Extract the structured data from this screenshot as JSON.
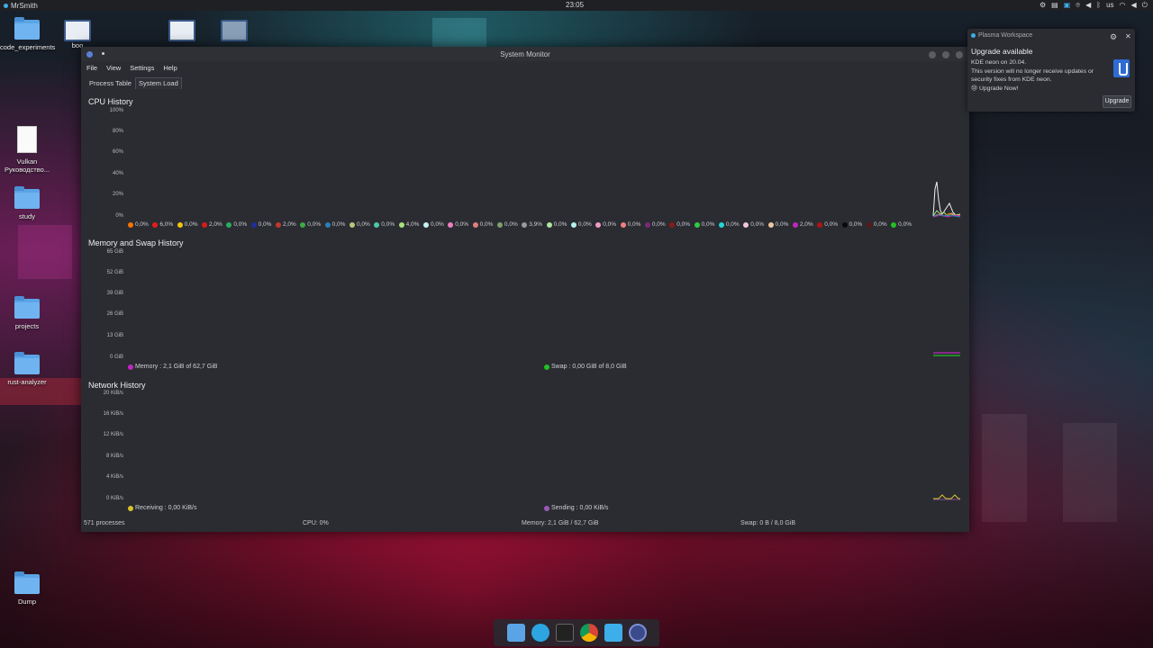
{
  "top_panel": {
    "user": "MrSmith",
    "clock": "23:05",
    "keyboard_layout": "us",
    "tray_icons": [
      "display-icon",
      "clipboard-icon",
      "discover-icon",
      "location-icon",
      "volume-icon",
      "bluetooth-icon",
      "keyboard-layout",
      "wifi-icon",
      "volume-icon-2",
      "power-icon"
    ]
  },
  "desktop": {
    "icons": [
      {
        "label": "code_experiments",
        "type": "folder"
      },
      {
        "label": "boo",
        "type": "app"
      },
      {
        "label": "",
        "type": "app"
      },
      {
        "label": "",
        "type": "app"
      },
      {
        "label": "Vulkan Руководство...",
        "type": "document"
      },
      {
        "label": "study",
        "type": "folder"
      },
      {
        "label": "projects",
        "type": "folder"
      },
      {
        "label": "rust-analyzer",
        "type": "folder"
      },
      {
        "label": "Dump",
        "type": "folder"
      }
    ]
  },
  "window": {
    "title": "System Monitor",
    "menu": [
      "File",
      "View",
      "Settings",
      "Help"
    ],
    "tabs": [
      {
        "label": "Process Table",
        "active": false
      },
      {
        "label": "System Load",
        "active": true
      }
    ],
    "cpu": {
      "title": "CPU History",
      "y_labels": [
        "100%",
        "80%",
        "60%",
        "40%",
        "20%",
        "0%"
      ],
      "legend": [
        {
          "color": "#f67400",
          "value": "0,0%"
        },
        {
          "color": "#e91a1a",
          "value": "6,0%"
        },
        {
          "color": "#f1c40f",
          "value": "0,0%"
        },
        {
          "color": "#d81b1b",
          "value": "2,0%"
        },
        {
          "color": "#27ae60",
          "value": "0,0%"
        },
        {
          "color": "#1d2f9a",
          "value": "0,0%"
        },
        {
          "color": "#c0392b",
          "value": "2,0%"
        },
        {
          "color": "#3daa42",
          "value": "0,0%"
        },
        {
          "color": "#2980b9",
          "value": "0,0%"
        },
        {
          "color": "#b4c97a",
          "value": "0,0%"
        },
        {
          "color": "#4ec9a7",
          "value": "0,0%"
        },
        {
          "color": "#a8e27c",
          "value": "4,0%"
        },
        {
          "color": "#c6f1f5",
          "value": "0,0%"
        },
        {
          "color": "#ef7fbf",
          "value": "0,0%"
        },
        {
          "color": "#e27f7f",
          "value": "0,0%"
        },
        {
          "color": "#7f9f6f",
          "value": "0,0%"
        },
        {
          "color": "#9a9a9a",
          "value": "3,9%"
        },
        {
          "color": "#aee6a0",
          "value": "0,0%"
        },
        {
          "color": "#b8f0f0",
          "value": "0,0%"
        },
        {
          "color": "#f19ac8",
          "value": "0,0%"
        },
        {
          "color": "#f08080",
          "value": "0,0%"
        },
        {
          "color": "#7a2a7a",
          "value": "0,0%"
        },
        {
          "color": "#8a1a1a",
          "value": "0,0%"
        },
        {
          "color": "#2ecc40",
          "value": "0,0%"
        },
        {
          "color": "#22d6d6",
          "value": "0,0%"
        },
        {
          "color": "#f2c6d6",
          "value": "0,0%"
        },
        {
          "color": "#f0c6a0",
          "value": "0,0%"
        },
        {
          "color": "#c026c0",
          "value": "2,0%"
        },
        {
          "color": "#b01414",
          "value": "0,0%"
        },
        {
          "color": "#0a0a0a",
          "value": "0,0%"
        },
        {
          "color": "#5a1a1a",
          "value": "0,0%"
        },
        {
          "color": "#22c022",
          "value": "0,0%"
        }
      ]
    },
    "memory": {
      "title": "Memory and Swap History",
      "y_labels": [
        "65 GiB",
        "52 GiB",
        "39 GiB",
        "26 GiB",
        "13 GiB",
        "0 GiB"
      ],
      "memory_label": "Memory : 2,1 GiB of 62,7 GiB",
      "memory_color": "#c026c0",
      "swap_label": "Swap : 0,00 GiB of 8,0 GiB",
      "swap_color": "#22c022"
    },
    "network": {
      "title": "Network History",
      "y_labels": [
        "20 KiB/s",
        "16 KiB/s",
        "12 KiB/s",
        "8 KiB/s",
        "4 KiB/s",
        "0 KiB/s"
      ],
      "receiving_label": "Receiving : 0,00 KiB/s",
      "receiving_color": "#d8c22e",
      "sending_label": "Sending : 0,00 KiB/s",
      "sending_color": "#9b59b6"
    },
    "status": {
      "processes": "571 processes",
      "cpu": "CPU: 0%",
      "memory": "Memory: 2,1 GiB / 62,7 GiB",
      "swap": "Swap: 0 B / 8,0 GiB"
    }
  },
  "notification": {
    "app": "Plasma Workspace",
    "heading": "Upgrade available",
    "line1": "KDE neon on 20.04.",
    "line2": "This version will no longer receive updates or security fixes from KDE neon.",
    "line3": "😢 Upgrade Now!",
    "button": "Upgrade"
  },
  "dock": {
    "items": [
      "files-icon",
      "telegram-icon",
      "inkscape-icon",
      "chrome-icon",
      "discover-icon",
      "system-monitor-icon"
    ]
  },
  "colors": {
    "window_bg": "#2a2c31",
    "panel_bg": "#1f2024",
    "accent": "#3daee9"
  }
}
